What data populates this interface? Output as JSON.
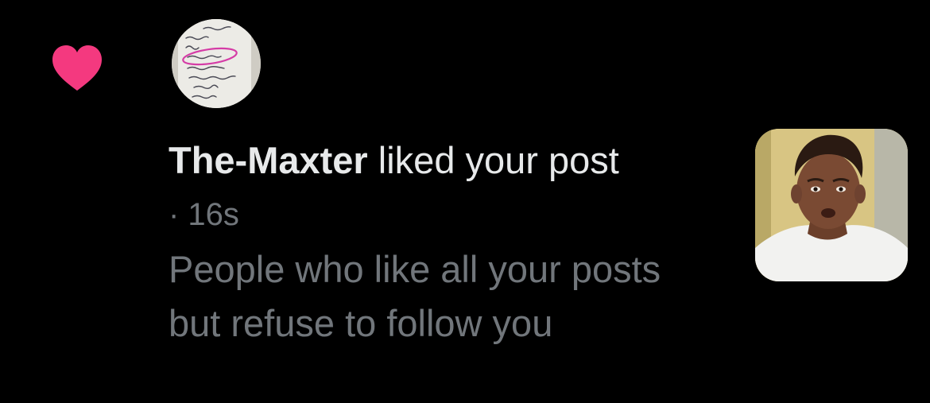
{
  "notification": {
    "type_icon": "heart-icon",
    "type_icon_color": "#f4397f",
    "avatar_icon": "user-avatar-note-photo",
    "username": "The-Maxter",
    "action_text": " liked your post",
    "timestamp": "· 16s",
    "post_text": "People who like all your posts but refuse to follow you",
    "post_thumbnail_icon": "post-thumbnail-photo"
  },
  "colors": {
    "background": "#000000",
    "primary_text": "#e7e9ea",
    "secondary_text": "#71767b",
    "like_pink": "#f4397f"
  }
}
